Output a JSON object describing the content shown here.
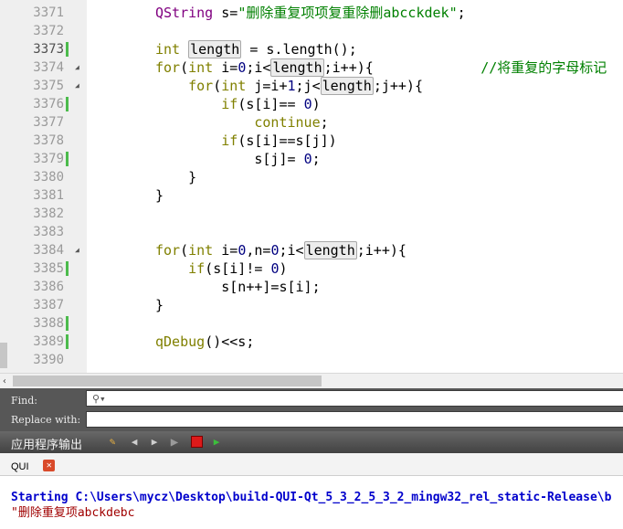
{
  "editor": {
    "lines": [
      {
        "n": "3371",
        "mark": false,
        "fold": false
      },
      {
        "n": "3372",
        "mark": false,
        "fold": false
      },
      {
        "n": "3373",
        "mark": true,
        "fold": false,
        "current": true
      },
      {
        "n": "3374",
        "mark": false,
        "fold": true
      },
      {
        "n": "3375",
        "mark": false,
        "fold": true
      },
      {
        "n": "3376",
        "mark": true,
        "fold": false
      },
      {
        "n": "3377",
        "mark": false,
        "fold": false
      },
      {
        "n": "3378",
        "mark": false,
        "fold": false
      },
      {
        "n": "3379",
        "mark": true,
        "fold": false
      },
      {
        "n": "3380",
        "mark": false,
        "fold": false
      },
      {
        "n": "3381",
        "mark": false,
        "fold": false
      },
      {
        "n": "3382",
        "mark": false,
        "fold": false
      },
      {
        "n": "3383",
        "mark": false,
        "fold": false
      },
      {
        "n": "3384",
        "mark": false,
        "fold": true
      },
      {
        "n": "3385",
        "mark": true,
        "fold": false
      },
      {
        "n": "3386",
        "mark": false,
        "fold": false
      },
      {
        "n": "3387",
        "mark": false,
        "fold": false
      },
      {
        "n": "3388",
        "mark": true,
        "fold": false
      },
      {
        "n": "3389",
        "mark": true,
        "fold": false
      },
      {
        "n": "3390",
        "mark": false,
        "fold": false
      }
    ],
    "code": [
      [
        {
          "t": "QString",
          "c": "typ"
        },
        {
          "t": " s="
        },
        {
          "t": "\"删除重复项项复重除删abcckdek\"",
          "c": "str"
        },
        {
          "t": ";"
        }
      ],
      [],
      [
        {
          "t": "int",
          "c": "kw"
        },
        {
          "t": " "
        },
        {
          "t": "length",
          "c": "hl"
        },
        {
          "t": " = s.length();"
        }
      ],
      [
        {
          "t": "for",
          "c": "kw"
        },
        {
          "t": "("
        },
        {
          "t": "int",
          "c": "kw"
        },
        {
          "t": " i="
        },
        {
          "t": "0",
          "c": "num"
        },
        {
          "t": ";i<"
        },
        {
          "t": "length",
          "c": "hl"
        },
        {
          "t": ";i++){             "
        },
        {
          "t": "//将重复的字母标记",
          "c": "com"
        }
      ],
      [
        {
          "t": "    "
        },
        {
          "t": "for",
          "c": "kw"
        },
        {
          "t": "("
        },
        {
          "t": "int",
          "c": "kw"
        },
        {
          "t": " j=i+"
        },
        {
          "t": "1",
          "c": "num"
        },
        {
          "t": ";j<"
        },
        {
          "t": "length",
          "c": "hl"
        },
        {
          "t": ";j++){"
        }
      ],
      [
        {
          "t": "        "
        },
        {
          "t": "if",
          "c": "kw"
        },
        {
          "t": "(s[i]== "
        },
        {
          "t": "0",
          "c": "num"
        },
        {
          "t": ")"
        }
      ],
      [
        {
          "t": "            "
        },
        {
          "t": "continue",
          "c": "kw"
        },
        {
          "t": ";"
        }
      ],
      [
        {
          "t": "        "
        },
        {
          "t": "if",
          "c": "kw"
        },
        {
          "t": "(s[i]==s[j])"
        }
      ],
      [
        {
          "t": "            s[j]= "
        },
        {
          "t": "0",
          "c": "num"
        },
        {
          "t": ";"
        }
      ],
      [
        {
          "t": "    }"
        }
      ],
      [
        {
          "t": "}"
        }
      ],
      [],
      [],
      [
        {
          "t": "for",
          "c": "kw"
        },
        {
          "t": "("
        },
        {
          "t": "int",
          "c": "kw"
        },
        {
          "t": " i="
        },
        {
          "t": "0",
          "c": "num"
        },
        {
          "t": ",n="
        },
        {
          "t": "0",
          "c": "num"
        },
        {
          "t": ";i<"
        },
        {
          "t": "length",
          "c": "hl"
        },
        {
          "t": ";i++){"
        }
      ],
      [
        {
          "t": "    "
        },
        {
          "t": "if",
          "c": "kw"
        },
        {
          "t": "(s[i]!= "
        },
        {
          "t": "0",
          "c": "num"
        },
        {
          "t": ")"
        }
      ],
      [
        {
          "t": "        s[n++]=s[i];"
        }
      ],
      [
        {
          "t": "}"
        }
      ],
      [],
      [
        {
          "t": "qDebug",
          "c": "kw"
        },
        {
          "t": "()<<s;"
        }
      ],
      []
    ]
  },
  "find": {
    "find_label": "Find:",
    "replace_label": "Replace with:",
    "find_value": "",
    "replace_value": ""
  },
  "output": {
    "title": "应用程序输出",
    "tab_label": "QUI",
    "close_glyph": "✕",
    "line1": "Starting C:\\Users\\mycz\\Desktop\\build-QUI-Qt_5_3_2_5_3_2_mingw32_rel_static-Release\\b",
    "line2": "\"删除重复项abckdebc"
  },
  "colors": {
    "keyword": "#808000",
    "string": "#008000",
    "number": "#000080",
    "type": "#800080",
    "gutter_mark": "#4cbb4c",
    "findbar_bg": "#575757",
    "output_path": "#0000cc",
    "output_text": "#a00000"
  }
}
